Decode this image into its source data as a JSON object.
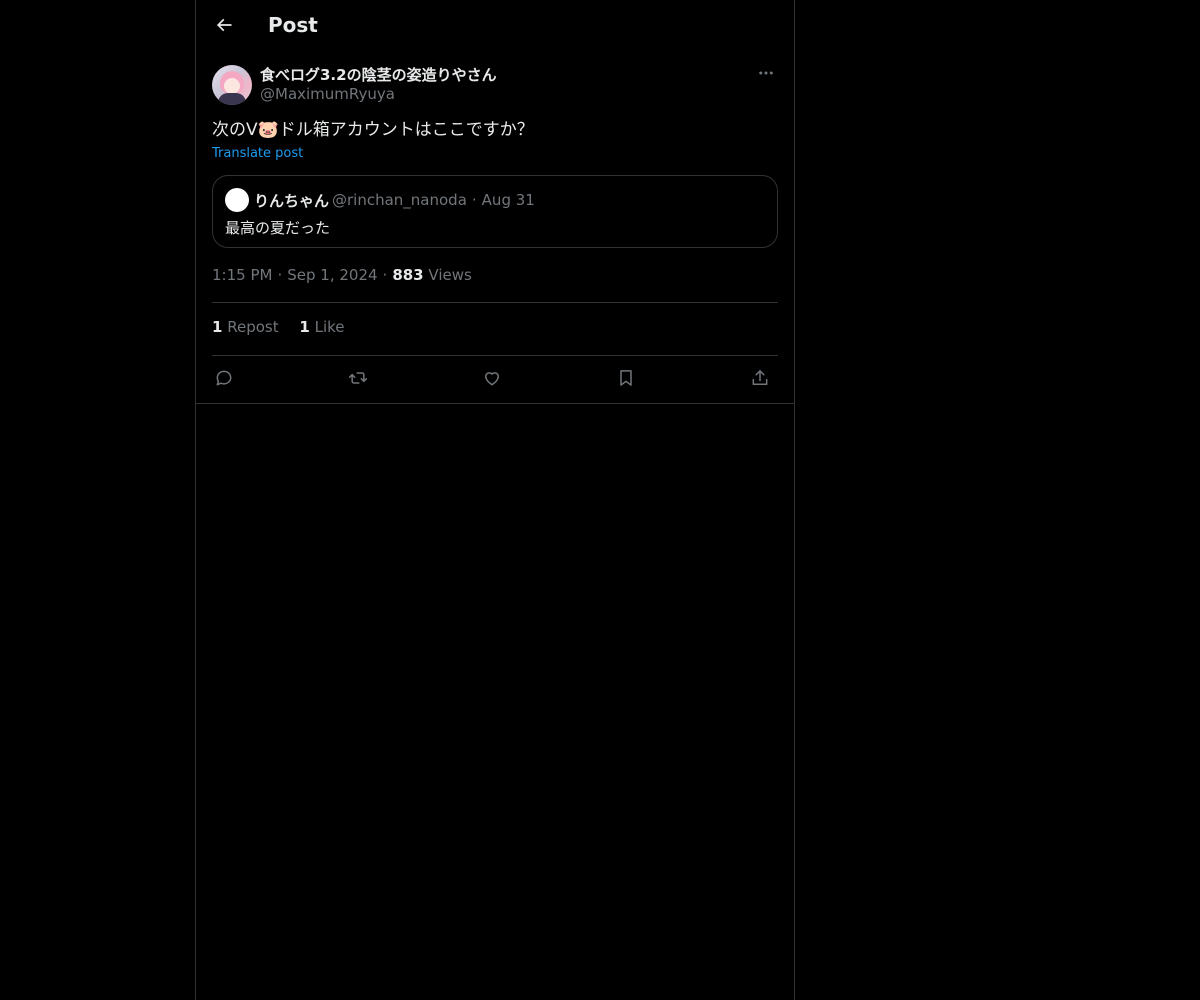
{
  "header": {
    "title": "Post"
  },
  "post": {
    "author_name": "食べログ3.2の陰茎の姿造りやさん",
    "author_handle": "@MaximumRyuya",
    "text": "次のV🐷ドル箱アカウントはここですか？",
    "translate_label": "Translate post",
    "time": "1:15 PM",
    "date": "Sep 1, 2024",
    "views_count": "883",
    "views_label": "Views"
  },
  "quote": {
    "name": "りんちゃん",
    "handle": "@rinchan_nanoda",
    "date": "Aug 31",
    "text": "最高の夏だった"
  },
  "stats": {
    "reposts_count": "1",
    "reposts_label": "Repost",
    "likes_count": "1",
    "likes_label": "Like"
  },
  "icons": {
    "back": "arrow-left-icon",
    "more": "more-dots-icon",
    "reply": "reply-icon",
    "repost": "repost-icon",
    "like": "heart-icon",
    "bookmark": "bookmark-icon",
    "share": "share-icon"
  },
  "colors": {
    "background": "#000000",
    "text": "#e7e9ea",
    "muted": "#71767b",
    "link": "#1d9bf0",
    "border": "#2f3336"
  }
}
